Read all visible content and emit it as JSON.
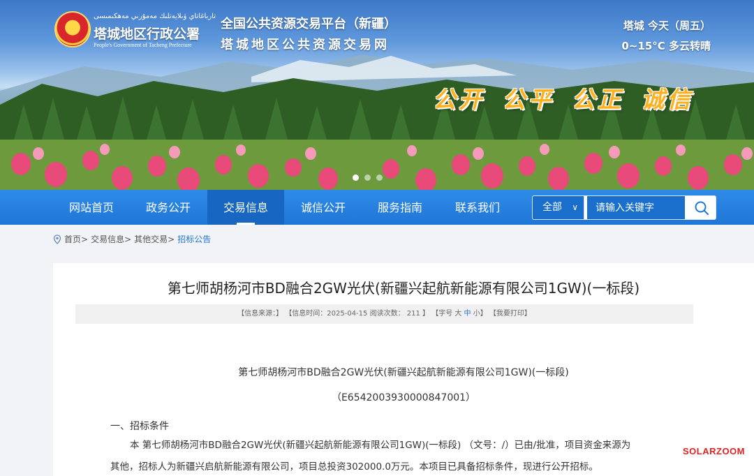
{
  "header": {
    "org_uyghur": "تارباغاتاي ۋىلايەتلىك مەمۇرىي مەھكىمىسى",
    "org_name": "塔城地区行政公署",
    "org_english": "People's Government of Tacheng Prefecture",
    "platform_line1": "全国公共资源交易平台（新疆）",
    "platform_line2": "塔城地区公共资源交易网",
    "weather_line1": "塔城  今天（周五）",
    "weather_line2": "0~15°C 多云转晴",
    "slogan": "公开 公平 公正 诚信"
  },
  "nav": {
    "items": [
      "网站首页",
      "政务公开",
      "交易信息",
      "诚信公开",
      "服务指南",
      "联系我们"
    ],
    "active_index": 2
  },
  "search": {
    "scope": "全部",
    "placeholder": "请输入关键字"
  },
  "breadcrumb": {
    "items": [
      "首页>",
      "交易信息>",
      "其他交易>"
    ],
    "current": "招标公告"
  },
  "article": {
    "title": "第七师胡杨河市BD融合2GW光伏(新疆兴起航新能源有限公司1GW)(一标段)",
    "meta_before": "【信息来源：】 【信息时间：2025-04-15  阅读次数： 211 】 【字号 大 ",
    "meta_mid": "中",
    "meta_after": " 小】 【我要打印】",
    "subtitle": "第七师胡杨河市BD融合2GW光伏(新疆兴起航新能源有限公司1GW)(一标段)",
    "code": "（E6542003930000847001）",
    "section1": "一、招标条件",
    "para1": "本 第七师胡杨河市BD融合2GW光伏(新疆兴起航新能源有限公司1GW)(一标段) （文号：/）已由/批准，项目资金来源为",
    "para2": "其他，招标人为新疆兴启航新能源有限公司，项目总投资302000.0万元。本项目已具备招标条件，现进行公开招标。"
  },
  "watermark": "SOLARZOOM",
  "colors": {
    "nav_blue": "#1f76d6",
    "slogan_orange": "#ffb020"
  }
}
